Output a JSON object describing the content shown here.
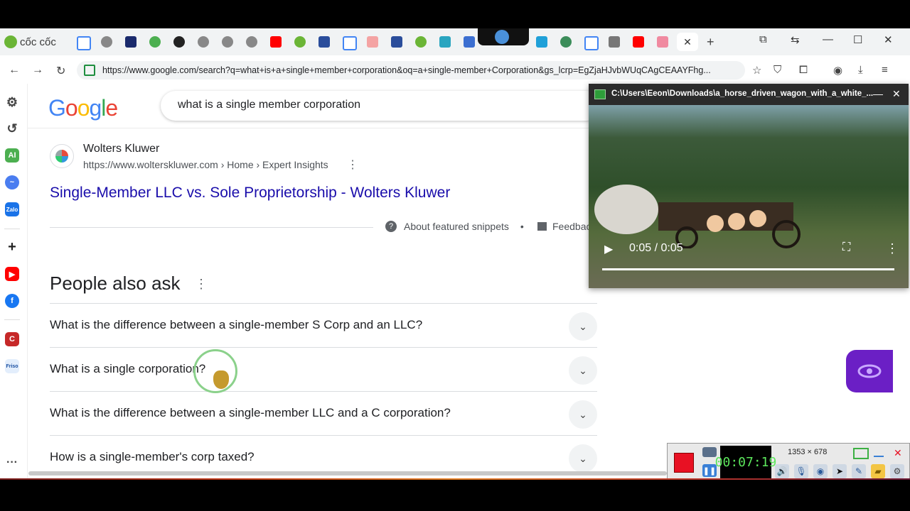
{
  "browser": {
    "brand": "cốc cốc",
    "url": "https://www.google.com/search?q=what+is+a+single+member+corporation&oq=a+single-member+Corporation&gs_lcrp=EgZjaHJvbWUqCAgCEAAYFhg...",
    "tab_close": "✕",
    "new_tab": "+",
    "accent": "#1e8e3e"
  },
  "search": {
    "logo": "Google",
    "query": "what is a single member corporation"
  },
  "result": {
    "site_name": "Wolters Kluwer",
    "site_url": "https://www.wolterskluwer.com › Home › Expert Insights",
    "title": "Single-Member LLC vs. Sole Proprietorship - Wolters Kluwer",
    "about_snippets": "About featured snippets",
    "feedback": "Feedback"
  },
  "paa": {
    "title": "People also ask",
    "questions": [
      "What is the difference between a single-member S Corp and an LLC?",
      "What is a single corporation?",
      "What is the difference between a single-member LLC and a C corporation?",
      "How is a single-member's corp taxed?"
    ]
  },
  "video": {
    "title": "C:\\Users\\Eeon\\Downloads\\a_horse_driven_wagon_with_a_white_...",
    "time": "0:05 / 0:05",
    "progress": 1.0
  },
  "recorder": {
    "time": "00:07:19",
    "size": "1353 × 678"
  }
}
